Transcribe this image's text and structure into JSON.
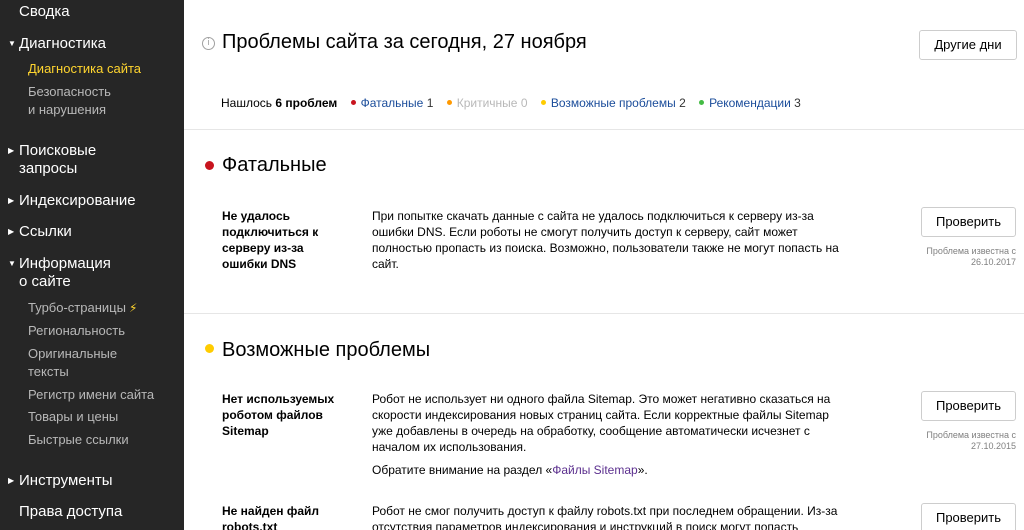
{
  "sidebar": {
    "items": [
      {
        "label": "Сводка"
      },
      {
        "label": "Диагностика"
      },
      {
        "label": "Диагностика сайта"
      },
      {
        "label_l1": "Безопасность",
        "label_l2": "и нарушения"
      },
      {
        "label_l1": "Поисковые",
        "label_l2": "запросы"
      },
      {
        "label": "Индексирование"
      },
      {
        "label": "Ссылки"
      },
      {
        "label_l1": "Информация",
        "label_l2": "о сайте"
      },
      {
        "label": "Турбо-страницы"
      },
      {
        "label": "Региональность"
      },
      {
        "label_l1": "Оригинальные",
        "label_l2": "тексты"
      },
      {
        "label": "Регистр имени сайта"
      },
      {
        "label": "Товары и цены"
      },
      {
        "label": "Быстрые ссылки"
      },
      {
        "label": "Инструменты"
      },
      {
        "label": "Права доступа"
      }
    ]
  },
  "header": {
    "info_glyph": "i",
    "title": "Проблемы сайта за сегодня, 27 ноября",
    "other_days_button": "Другие дни"
  },
  "summary": {
    "found_prefix": "Нашлось",
    "found_count": "6 проблем",
    "fatal_label": "Фатальные",
    "fatal_count": "1",
    "critical_label": "Критичные",
    "critical_count": "0",
    "possible_label": "Возможные проблемы",
    "possible_count": "2",
    "recommend_label": "Рекомендации",
    "recommend_count": "3"
  },
  "sections": {
    "fatal": {
      "title": "Фатальные",
      "problem": {
        "title_lines": [
          "Не удалось",
          "подключиться к",
          "серверу из-за",
          "ошибки DNS"
        ],
        "desc_lines": [
          "При попытке скачать данные с сайта не удалось подключиться к серверу из-за",
          "ошибки DNS. Если роботы не смогут получить доступ к серверу, сайт может",
          "полностью пропасть из поиска. Возможно, пользователи также не могут попасть на",
          "сайт."
        ],
        "check_button": "Проверить",
        "known_l1": "Проблема известна с",
        "known_l2": "26.10.2017"
      }
    },
    "possible": {
      "title": "Возможные проблемы",
      "problem1": {
        "title_lines": [
          "Нет используемых",
          "роботом файлов",
          "Sitemap"
        ],
        "desc_lines": [
          "Робот не использует ни одного файла Sitemap. Это может негативно сказаться на",
          "скорости индексирования новых страниц сайта. Если корректные файлы Sitemap",
          "уже добавлены в очередь на обработку, сообщение автоматически исчезнет с",
          "началом их использования."
        ],
        "note_prefix": "Обратите внимание на раздел «",
        "note_link": "Файлы Sitemap",
        "note_suffix": "».",
        "check_button": "Проверить",
        "known_l1": "Проблема известна с",
        "known_l2": "27.10.2015"
      },
      "problem2": {
        "title_lines": [
          "Не найден файл",
          "robots.txt"
        ],
        "desc_lines": [
          "Робот не смог получить доступ к файлу robots.txt при последнем обращении. Из-за",
          "отсутствия параметров индексирования и инструкций в поиск могут попасть"
        ],
        "check_button": "Проверить"
      }
    }
  },
  "colors": {
    "sidebar_bg": "#262626",
    "active_nav": "#ffd52f",
    "fatal": "#c8141e",
    "critical": "#ff9900",
    "possible": "#ffcc00",
    "recommend": "#44bb44",
    "link": "#1a4c9a"
  }
}
